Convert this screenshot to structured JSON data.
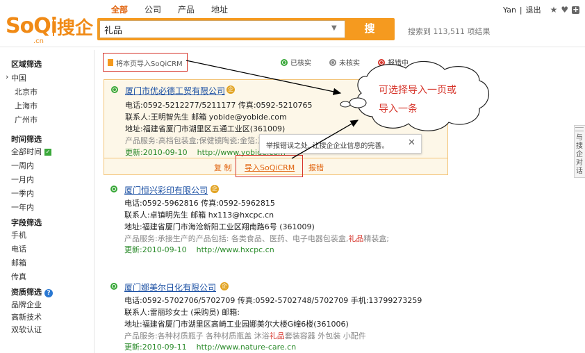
{
  "header": {
    "logo": {
      "brand": "SoQi",
      "chs": "搜企",
      "domain": ".cn"
    },
    "tabs": [
      "全部",
      "公司",
      "产品",
      "地址"
    ],
    "search_value": "礼品",
    "search_button": "搜",
    "result_count": "搜索到 113,511 项结果",
    "user": "Yan",
    "sep": "|",
    "logout": "退出"
  },
  "sidebar": {
    "region": {
      "title": "区域筛选",
      "items": [
        "中国",
        "北京市",
        "上海市",
        "广州市"
      ]
    },
    "time": {
      "title": "时间筛选",
      "items": [
        "全部时间",
        "一周内",
        "一月内",
        "一季内",
        "一年内"
      ]
    },
    "field": {
      "title": "字段筛选",
      "items": [
        "手机",
        "电话",
        "邮箱",
        "传真"
      ]
    },
    "qual": {
      "title": "资质筛选",
      "help": "?",
      "items": [
        "品牌企业",
        "高新技术",
        "双软认证"
      ]
    }
  },
  "toolbar": {
    "import_label": "将本页导入SoQiCRM",
    "legend": [
      "已核实",
      "未核实",
      "报错中"
    ]
  },
  "results": [
    {
      "title": "厦门市优必德工贸有限公司",
      "badge": "企",
      "phone": "电话:0592-5212277/5211177  传真:0592-5210765",
      "contact": "联系人:王明智先生  邮箱 yobide@yobide.com",
      "address": "地址:福建省厦门市湖里区五通工业区(361009)",
      "service": "产品服务:高档包装盒;保健镜陶瓷;金箔;工",
      "updated_label": "更新:2010-09-10",
      "url": "http://www.yobide.com",
      "actions": [
        "复 制",
        "导入SoQiCRM",
        "报错"
      ]
    },
    {
      "title": "厦门恒兴彩印有限公司",
      "badge": "企",
      "phone": "电话:0592-5962816  传真:0592-5962815",
      "contact": "联系人:卓镇明先生  邮箱 hx113@hxcpc.cn",
      "address": "地址:福建省厦门市海沧新阳工业区翔南路6号 (361009)",
      "service_pre": "产品服务:承接生产的产品包括: 各类食品、医药、电子电器包装盒,",
      "service_kw": "礼品",
      "service_post": "精装盒;",
      "updated_label": "更新:2010-09-10",
      "url": "http://www.hxcpc.cn"
    },
    {
      "title": "厦门娜美尔日化有限公司",
      "badge": "企",
      "phone": "电话:0592-5702706/5702709  传真:0592-5702748/5702709  手机:13799273259",
      "contact": "联系人:雷丽珍女士 (采购员)   邮箱:",
      "address": "地址:福建省厦门市湖里区高崎工业园娜美尔大楼G幢6楼(361006)",
      "service_pre": "产品服务:各种材质瓶子 各种材质瓶盖 沐浴",
      "service_kw": "礼品",
      "service_post": "套装容器 外包装 小配件",
      "updated_label": "更新:2010-09-11",
      "url": "http://www.nature-care.cn"
    }
  ],
  "tooltip": {
    "text": "举报错误之处, 让搜企企业信息的完善。",
    "close": "✕"
  },
  "callout": {
    "line1": "可选择导入一页或",
    "line2": "导入一条"
  },
  "side_tab": {
    "text": "与搜企对话"
  },
  "colors": {
    "brand_orange": "#f59a1f",
    "link_blue": "#1a4fa3",
    "verified_green": "#3aa83a",
    "callout_red": "#d6342a"
  }
}
